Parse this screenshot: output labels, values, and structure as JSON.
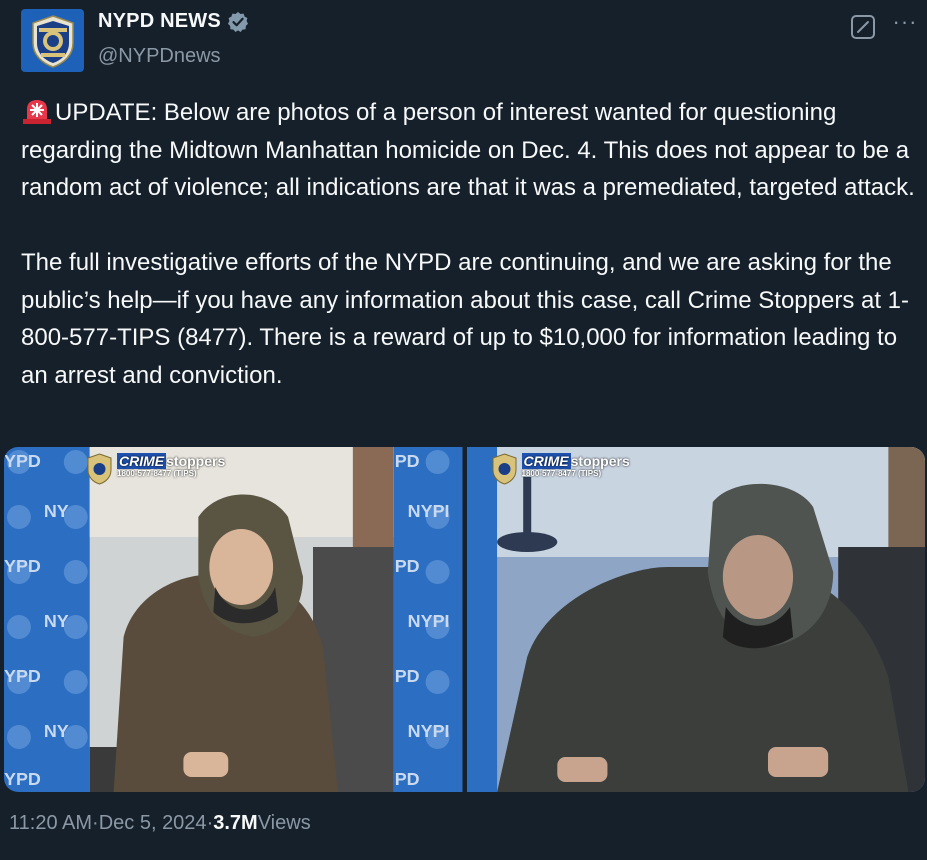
{
  "author": {
    "display_name": "NYPD NEWS",
    "handle": "@NYPDnews",
    "verified": true
  },
  "tweet": {
    "emoji": "siren-icon",
    "paragraph1": "UPDATE: Below are photos of a person of interest wanted for questioning regarding the Midtown Manhattan homicide on Dec. 4. This does not appear to be a random act of violence; all indications are that it was a premediated, targeted attack.",
    "paragraph2": "The full investigative efforts of the NYPD are continuing, and we are asking for the public’s help—if you have any information about this case, call Crime Stoppers at 1-800-577-TIPS (8477). There is a reward of up to $10,000 for information leading to an arrest and conviction."
  },
  "media": {
    "logo_crime": "CRIME",
    "logo_stoppers": "stoppers",
    "logo_phone": "1800-577-8477 (TIPS)",
    "wall_text": [
      "YPD",
      "NYPD"
    ]
  },
  "meta": {
    "time": "11:20 AM",
    "separator": " · ",
    "date": "Dec 5, 2024",
    "views_count": "3.7M",
    "views_label": " Views"
  },
  "colors": {
    "background": "#15202b",
    "text": "#f7f9f9",
    "secondary": "#8b98a5",
    "verified_badge": "#829aab",
    "nypd_blue": "#1d62b8"
  }
}
